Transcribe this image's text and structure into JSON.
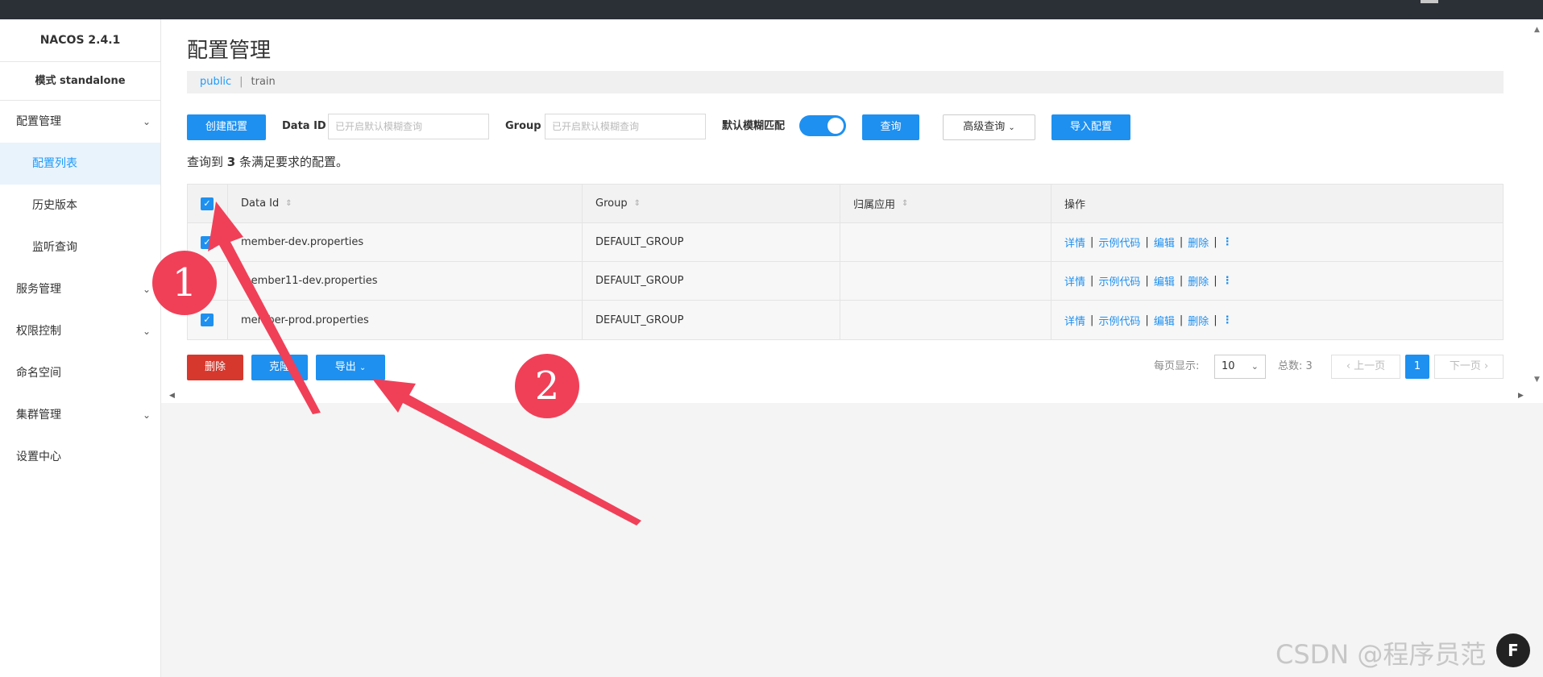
{
  "app": {
    "brand": "NACOS 2.4.1",
    "mode": "模式 standalone"
  },
  "sidebar": {
    "items": [
      {
        "label": "配置管理",
        "chevron": "chevron-down-icon",
        "active": false,
        "sub": false
      },
      {
        "label": "配置列表",
        "active": true,
        "sub": true
      },
      {
        "label": "历史版本",
        "active": false,
        "sub": true
      },
      {
        "label": "监听查询",
        "active": false,
        "sub": true
      },
      {
        "label": "服务管理",
        "chevron": "chevron-down-icon",
        "active": false,
        "sub": false
      },
      {
        "label": "权限控制",
        "chevron": "chevron-down-icon",
        "active": false,
        "sub": false
      },
      {
        "label": "命名空间",
        "active": false,
        "sub": false
      },
      {
        "label": "集群管理",
        "chevron": "chevron-down-icon",
        "active": false,
        "sub": false
      },
      {
        "label": "设置中心",
        "active": false,
        "sub": false
      }
    ]
  },
  "header": {
    "title": "配置管理",
    "namespace": "public",
    "separator": "|",
    "env": "train"
  },
  "toolbar": {
    "create_label": "创建配置",
    "data_id_label": "Data ID",
    "data_id_placeholder": "已开启默认模糊查询",
    "group_label": "Group",
    "group_placeholder": "已开启默认模糊查询",
    "fuzzy_label": "默认模糊匹配",
    "fuzzy_on": true,
    "query_label": "查询",
    "advanced_label": "高级查询",
    "import_label": "导入配置"
  },
  "summary": {
    "prefix": "查询到",
    "count": "3",
    "suffix": "条满足要求的配置。"
  },
  "table": {
    "columns": [
      "Data Id",
      "Group",
      "归属应用",
      "操作"
    ],
    "rows": [
      {
        "data_id": "member-dev.properties",
        "group": "DEFAULT_GROUP",
        "app": "",
        "checked": true
      },
      {
        "data_id": "member11-dev.properties",
        "group": "DEFAULT_GROUP",
        "app": "",
        "checked": true
      },
      {
        "data_id": "member-prod.properties",
        "group": "DEFAULT_GROUP",
        "app": "",
        "checked": true
      }
    ],
    "ops": [
      "详情",
      "示例代码",
      "编辑",
      "删除"
    ],
    "op_sep": "|"
  },
  "bulk": {
    "delete_label": "删除",
    "clone_label": "克隆",
    "export_label": "导出"
  },
  "pager": {
    "per_page_label": "每页显示:",
    "per_page_value": "10",
    "total_label": "总数:",
    "total_value": "3",
    "prev_label": "上一页",
    "current_page": "1",
    "next_label": "下一页"
  },
  "annotations": {
    "step1": "1",
    "step2": "2",
    "arrow_color": "#f04058"
  },
  "watermark": {
    "text": "CSDN @程序员范",
    "logo_text": "F"
  }
}
